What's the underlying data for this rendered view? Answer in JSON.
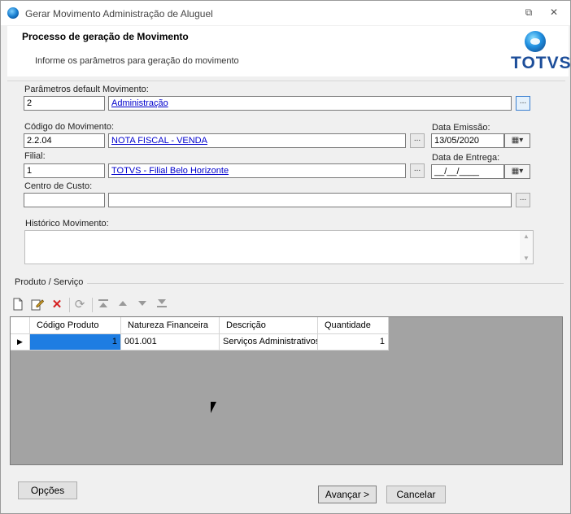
{
  "window": {
    "title": "Gerar Movimento Administração de Aluguel",
    "restore_glyph": "⧉",
    "close_glyph": "✕"
  },
  "header": {
    "title": "Processo de geração de Movimento",
    "subtitle": "Informe os parâmetros para geração do movimento",
    "logo_text": "TOTVS",
    "brand_color": "#1d4e9a"
  },
  "form": {
    "default_mov": {
      "label": "Parâmetros default Movimento:",
      "code": "2",
      "desc": "Administração",
      "lookup": "..."
    },
    "codigo_mov": {
      "label": "Código do Movimento:",
      "code": "2.2.04",
      "desc": "NOTA FISCAL - VENDA",
      "lookup": "..."
    },
    "data_emissao": {
      "label": "Data Emissão:",
      "value": "13/05/2020",
      "icon": "calendar-icon"
    },
    "filial": {
      "label": "Filial:",
      "code": "1",
      "desc": "TOTVS - Filial Belo Horizonte",
      "lookup": "..."
    },
    "data_entrega": {
      "label": "Data de Entrega:",
      "value": "__/__/____",
      "icon": "calendar-icon"
    },
    "centro_custo": {
      "label": "Centro de Custo:",
      "code": "",
      "desc": "",
      "lookup": "..."
    },
    "historico": {
      "label": "Histórico Movimento:",
      "value": ""
    }
  },
  "produto": {
    "group_label": "Produto / Serviço",
    "toolbar_icons": [
      "new-icon",
      "edit-icon",
      "delete-icon",
      "refresh-icon",
      "move-first-icon",
      "move-up-icon",
      "move-down-icon",
      "move-last-icon"
    ],
    "columns": [
      "Código Produto",
      "Natureza Financeira",
      "Descrição",
      "Quantidade"
    ],
    "rows": [
      {
        "indicator": "▶",
        "codigo": "1",
        "natureza": "001.001",
        "descricao": "Serviços Administrativos",
        "quantidade": "1"
      }
    ]
  },
  "footer": {
    "opcoes": "Opções",
    "avancar": "Avançar >",
    "cancelar": "Cancelar"
  }
}
